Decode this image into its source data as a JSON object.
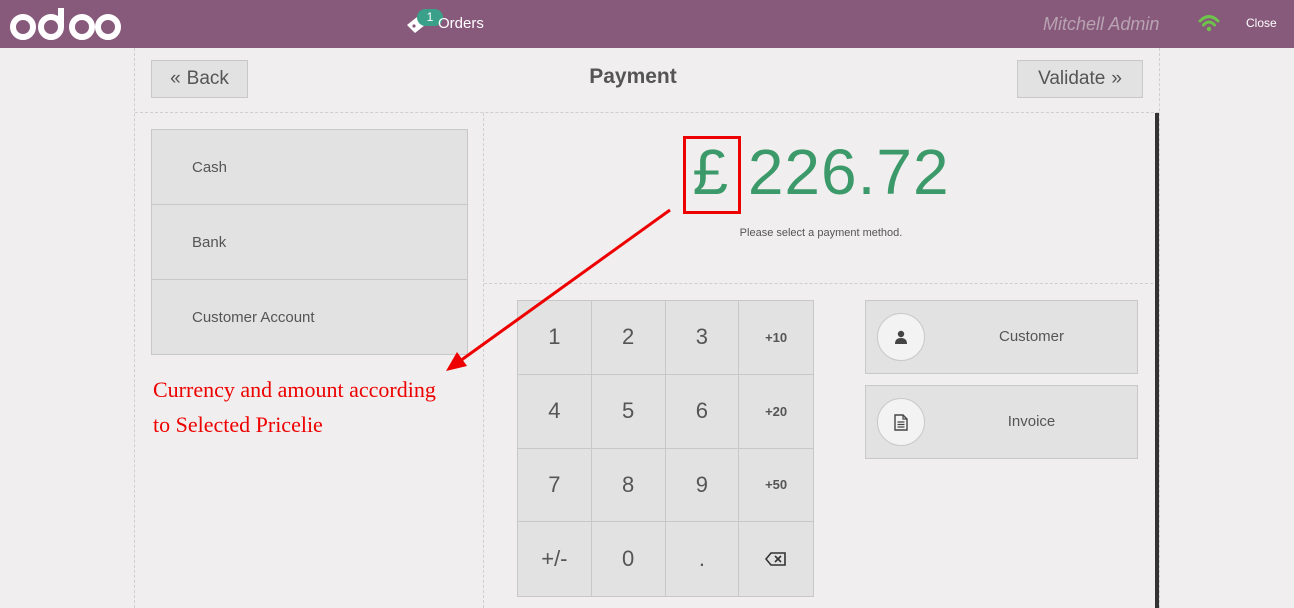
{
  "topbar": {
    "logo_text": "odoo",
    "orders_badge": "1",
    "orders_label": "Orders",
    "user": "Mitchell Admin",
    "close_label": "Close",
    "wifi_icon": "wifi-icon",
    "ticket_icon": "ticket-icon"
  },
  "header": {
    "back_label": "Back",
    "title": "Payment",
    "validate_label": "Validate"
  },
  "payment_methods": [
    "Cash",
    "Bank",
    "Customer Account"
  ],
  "amount": {
    "currency": "£",
    "value": "226.72",
    "hint": "Please select a payment method."
  },
  "numpad": [
    "1",
    "2",
    "3",
    "+10",
    "4",
    "5",
    "6",
    "+20",
    "7",
    "8",
    "9",
    "+50",
    "+/-",
    "0",
    ".",
    "⌫"
  ],
  "actions": {
    "customer_label": "Customer",
    "invoice_label": "Invoice"
  },
  "annotation": {
    "line1": "Currency and amount according",
    "line2": "to Selected Pricelie"
  },
  "colors": {
    "topbar": "#875a7b",
    "amount": "#3c9a6a",
    "annotation": "#ee0000"
  }
}
